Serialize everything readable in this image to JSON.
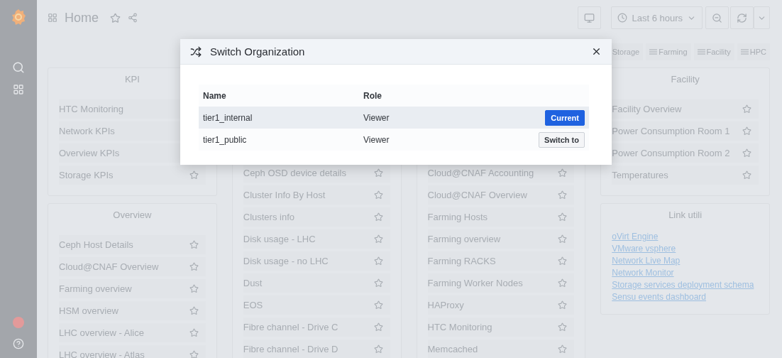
{
  "topbar": {
    "title": "Home",
    "time_range": "Last 6 hours"
  },
  "dashboard_links": [
    "Storage",
    "Farming",
    "Facility",
    "HPC"
  ],
  "columns": [
    {
      "panels": [
        {
          "title": "KPI",
          "items": [
            "HTC Monitoring",
            "Network KPIs",
            "Overview KPIs",
            "Storage KPIs"
          ]
        },
        {
          "title": "Overview",
          "items": [
            "Ceph Host Details",
            "Cloud@CNAF Overview",
            "Farming overview",
            "HSM overview",
            "LHC overview - Alice",
            "LHC overview - Atlas"
          ]
        }
      ]
    },
    {
      "panels": [
        {
          "items": [
            "Ceph OSD device details",
            "Cluster Info By Host",
            "Clusters info",
            "Disk usage - LHC",
            "Disk usage - no LHC",
            "Dust",
            "EOS",
            "Fibre channel - Drive C",
            "Fibre channel - Drive D"
          ]
        }
      ]
    },
    {
      "panels": [
        {
          "items": [
            "Cloud@CNAF Accounting",
            "Cloud@CNAF Overview",
            "Farming Hosts",
            "Farming overview",
            "Farming RACKS",
            "Farming Worker Nodes",
            "HAProxy",
            "HTC Monitoring",
            "Memcached"
          ]
        }
      ]
    },
    {
      "panels": [
        {
          "title": "Facility",
          "items": [
            "Facility Overview",
            "Power Consumption Room 1",
            "Power Consumption Room 2",
            "Temperatures"
          ]
        },
        {
          "title": "Link utili",
          "links": [
            "oVirt Engine",
            "VMware vsphere",
            "Network Live Map",
            "Network Monitor",
            "Storage services deployment schema",
            "Sensu events dashboard"
          ]
        }
      ]
    }
  ],
  "modal": {
    "title": "Switch Organization",
    "columns": [
      "Name",
      "Role"
    ],
    "rows": [
      {
        "name": "tier1_internal",
        "role": "Viewer",
        "action": "Current",
        "selected": true
      },
      {
        "name": "tier1_public",
        "role": "Viewer",
        "action": "Switch to",
        "selected": false
      }
    ]
  }
}
